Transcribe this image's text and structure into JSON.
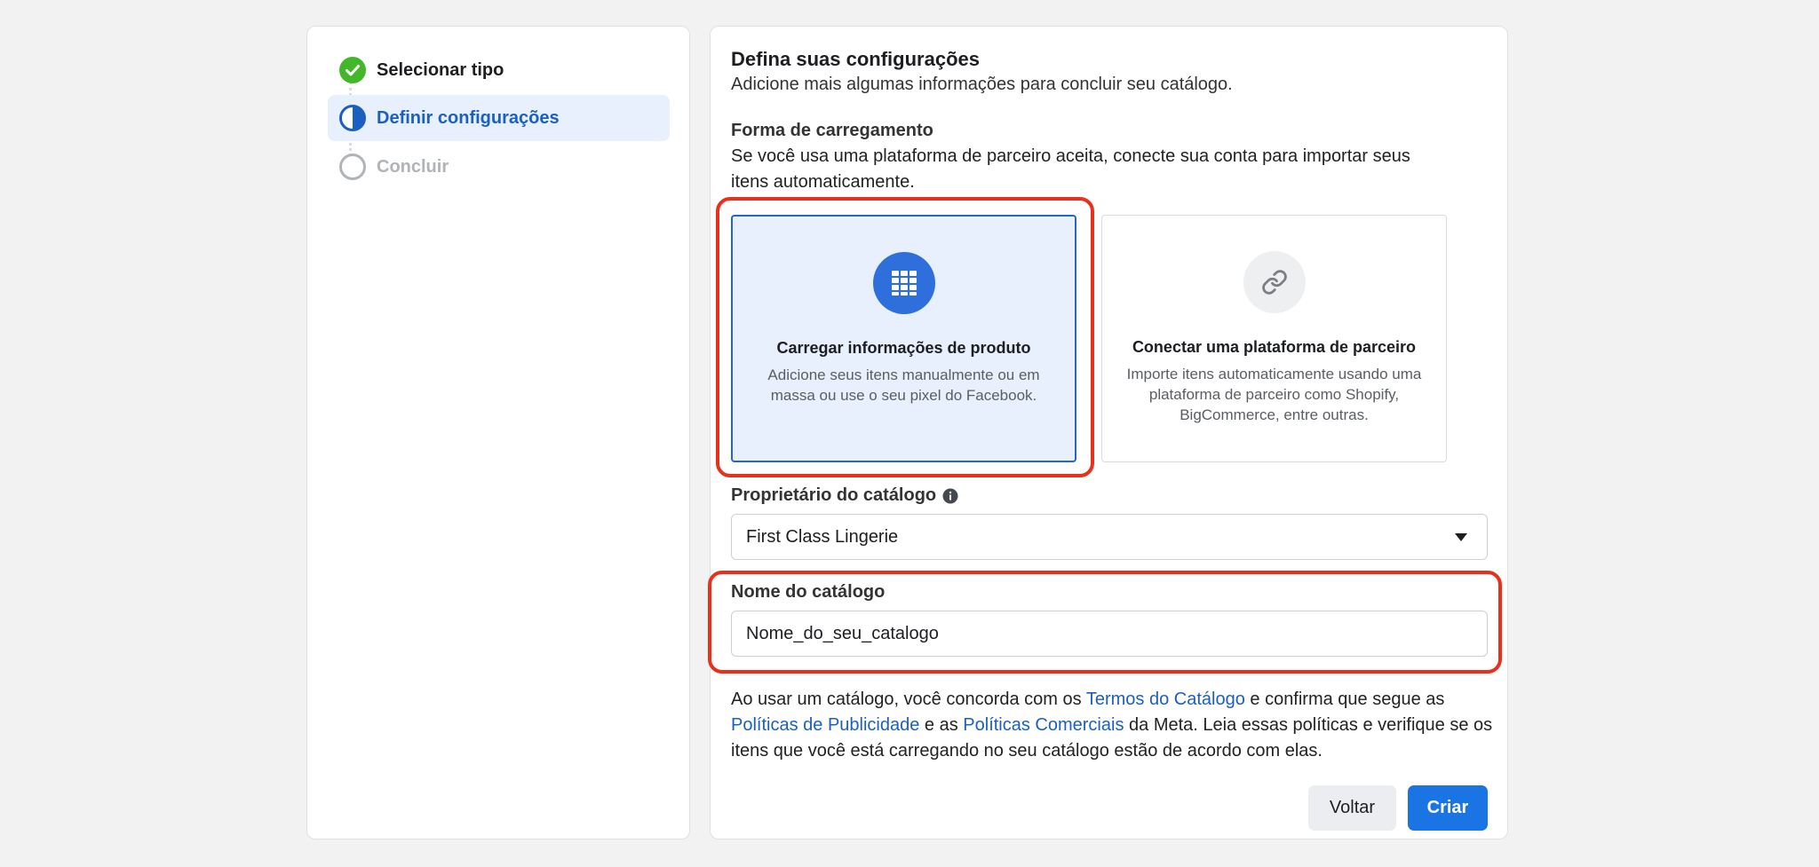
{
  "steps": [
    {
      "label": "Selecionar tipo",
      "state": "done"
    },
    {
      "label": "Definir configurações",
      "state": "active"
    },
    {
      "label": "Concluir",
      "state": "pending"
    }
  ],
  "header": {
    "title": "Defina suas configurações",
    "subtitle": "Adicione mais algumas informações para concluir seu catálogo."
  },
  "upload": {
    "title": "Forma de carregamento",
    "description": "Se você usa uma plataforma de parceiro aceita, conecte sua conta para importar seus itens automaticamente.",
    "options": [
      {
        "title": "Carregar informações de produto",
        "description": "Adicione seus itens manualmente ou em massa ou use o seu pixel do Facebook.",
        "icon": "grid-icon",
        "selected": true
      },
      {
        "title": "Conectar uma plataforma de parceiro",
        "description": "Importe itens automaticamente usando uma plataforma de parceiro como Shopify, BigCommerce, entre outras.",
        "icon": "link-icon",
        "selected": false
      }
    ]
  },
  "owner": {
    "label": "Proprietário do catálogo",
    "value": "First Class Lingerie"
  },
  "catalog_name": {
    "label": "Nome do catálogo",
    "value": "Nome_do_seu_catalogo"
  },
  "terms": {
    "part1": "Ao usar um catálogo, você concorda com os ",
    "link1": "Termos do Catálogo",
    "part2": " e confirma que segue as ",
    "link2": "Políticas de Publicidade",
    "part3": " e as ",
    "link3": "Políticas Comerciais",
    "part4": " da Meta. Leia essas políticas e verifique se os itens que você está carregando no seu catálogo estão de acordo com elas."
  },
  "buttons": {
    "back": "Voltar",
    "create": "Criar"
  },
  "colors": {
    "primary": "#1b74e4",
    "success": "#42b72a",
    "annotation": "#e8301c"
  }
}
